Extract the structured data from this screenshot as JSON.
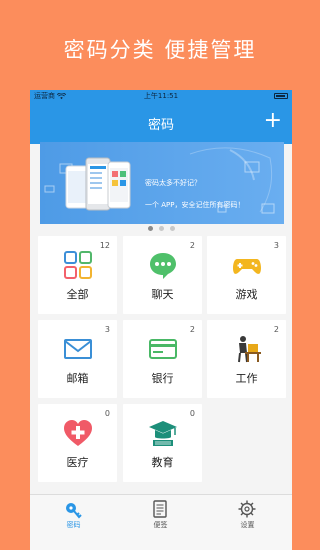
{
  "promo": {
    "title": "密码分类   便捷管理"
  },
  "status": {
    "carrier": "运营商",
    "time": "上午11:51"
  },
  "nav": {
    "title": "密码",
    "add_label": "+"
  },
  "banner": {
    "line1": "密码太多不好记？",
    "line2": "一个 APP，安全记住所有密码！"
  },
  "pagination": {
    "total": 3,
    "active": 0
  },
  "categories": [
    {
      "label": "全部",
      "count": "12",
      "icon": "grid-icon"
    },
    {
      "label": "聊天",
      "count": "2",
      "icon": "chat-icon"
    },
    {
      "label": "游戏",
      "count": "3",
      "icon": "gamepad-icon"
    },
    {
      "label": "邮箱",
      "count": "3",
      "icon": "mail-icon"
    },
    {
      "label": "银行",
      "count": "2",
      "icon": "bank-card-icon"
    },
    {
      "label": "工作",
      "count": "2",
      "icon": "work-icon"
    },
    {
      "label": "医疗",
      "count": "0",
      "icon": "medical-icon"
    },
    {
      "label": "教育",
      "count": "0",
      "icon": "education-icon"
    }
  ],
  "tabs": [
    {
      "label": "密码",
      "icon": "key-icon",
      "active": true
    },
    {
      "label": "便签",
      "icon": "note-icon",
      "active": false
    },
    {
      "label": "设置",
      "icon": "gear-icon",
      "active": false
    }
  ],
  "colors": {
    "background": "#fc8d5c",
    "primary": "#2a96e6"
  }
}
